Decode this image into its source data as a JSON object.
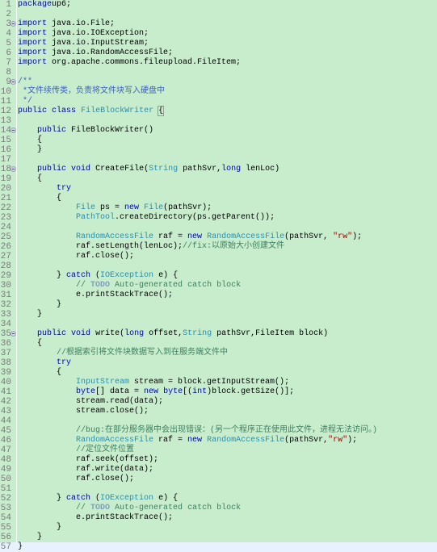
{
  "editor": {
    "language": "java",
    "colors": {
      "background": "#c7edcc",
      "current_line": "#e8f2fe",
      "keyword": "#0000c0",
      "type": "#2a8fb0",
      "string": "#a00000",
      "comment": "#3f7f5f",
      "javadoc": "#3f5fbf",
      "todo": "#7f9fbf",
      "line_number": "#787878"
    },
    "fold_markers": [
      3,
      9,
      14,
      18,
      35
    ],
    "current_line": 57,
    "lines": [
      {
        "n": "1",
        "tokens": [
          [
            "kw",
            "package"
          ],
          [
            "",
            "up6;"
          ]
        ]
      },
      {
        "n": "2",
        "tokens": []
      },
      {
        "n": "3",
        "tokens": [
          [
            "kw",
            "import"
          ],
          [
            "",
            " java.io.File;"
          ]
        ]
      },
      {
        "n": "4",
        "tokens": [
          [
            "kw",
            "import"
          ],
          [
            "",
            " java.io.IOException;"
          ]
        ]
      },
      {
        "n": "5",
        "tokens": [
          [
            "kw",
            "import"
          ],
          [
            "",
            " java.io.InputStream;"
          ]
        ]
      },
      {
        "n": "6",
        "tokens": [
          [
            "kw",
            "import"
          ],
          [
            "",
            " java.io.RandomAccessFile;"
          ]
        ]
      },
      {
        "n": "7",
        "tokens": [
          [
            "kw",
            "import"
          ],
          [
            "",
            " org.apache.commons.fileupload.FileItem;"
          ]
        ]
      },
      {
        "n": "8",
        "tokens": []
      },
      {
        "n": "9",
        "tokens": [
          [
            "jd",
            "/**"
          ]
        ]
      },
      {
        "n": "10",
        "tokens": [
          [
            "jd",
            " *文件续传类，负责将文件块写入硬盘中"
          ]
        ]
      },
      {
        "n": "11",
        "tokens": [
          [
            "jd",
            " */"
          ]
        ]
      },
      {
        "n": "12",
        "tokens": [
          [
            "kw",
            "public"
          ],
          [
            "",
            " "
          ],
          [
            "kw",
            "class"
          ],
          [
            "",
            " "
          ],
          [
            "ty",
            "FileBlockWriter"
          ],
          [
            "",
            " "
          ],
          [
            "brace",
            "{"
          ]
        ]
      },
      {
        "n": "13",
        "tokens": []
      },
      {
        "n": "14",
        "tokens": [
          [
            "",
            "    "
          ],
          [
            "kw",
            "public"
          ],
          [
            "",
            " FileBlockWriter()"
          ]
        ]
      },
      {
        "n": "15",
        "tokens": [
          [
            "",
            "    {"
          ]
        ]
      },
      {
        "n": "16",
        "tokens": [
          [
            "",
            "    }"
          ]
        ]
      },
      {
        "n": "17",
        "tokens": []
      },
      {
        "n": "18",
        "tokens": [
          [
            "",
            "    "
          ],
          [
            "kw",
            "public"
          ],
          [
            "",
            " "
          ],
          [
            "kw",
            "void"
          ],
          [
            "",
            " CreateFile("
          ],
          [
            "ty",
            "String"
          ],
          [
            "",
            " pathSvr,"
          ],
          [
            "kw",
            "long"
          ],
          [
            "",
            " lenLoc)"
          ]
        ]
      },
      {
        "n": "19",
        "tokens": [
          [
            "",
            "    {"
          ]
        ]
      },
      {
        "n": "20",
        "tokens": [
          [
            "",
            "        "
          ],
          [
            "kw",
            "try"
          ]
        ]
      },
      {
        "n": "21",
        "tokens": [
          [
            "",
            "        {"
          ]
        ]
      },
      {
        "n": "22",
        "tokens": [
          [
            "",
            "            "
          ],
          [
            "ty",
            "File"
          ],
          [
            "",
            " ps = "
          ],
          [
            "kw",
            "new"
          ],
          [
            "",
            " "
          ],
          [
            "ty",
            "File"
          ],
          [
            "",
            "(pathSvr);"
          ]
        ]
      },
      {
        "n": "23",
        "tokens": [
          [
            "",
            "            "
          ],
          [
            "ty",
            "PathTool"
          ],
          [
            "",
            ".createDirectory(ps.getParent());"
          ]
        ]
      },
      {
        "n": "24",
        "tokens": []
      },
      {
        "n": "25",
        "tokens": [
          [
            "",
            "            "
          ],
          [
            "ty",
            "RandomAccessFile"
          ],
          [
            "",
            " raf = "
          ],
          [
            "kw",
            "new"
          ],
          [
            "",
            " "
          ],
          [
            "ty",
            "RandomAccessFile"
          ],
          [
            "",
            "(pathSvr, "
          ],
          [
            "str",
            "\"rw\""
          ],
          [
            "",
            ");"
          ]
        ]
      },
      {
        "n": "26",
        "tokens": [
          [
            "",
            "            raf.setLength(lenLoc);"
          ],
          [
            "cm",
            "//fix:以原始大小创建文件"
          ]
        ]
      },
      {
        "n": "27",
        "tokens": [
          [
            "",
            "            raf.close();"
          ]
        ]
      },
      {
        "n": "28",
        "tokens": []
      },
      {
        "n": "29",
        "tokens": [
          [
            "",
            "        } "
          ],
          [
            "kw",
            "catch"
          ],
          [
            "",
            " ("
          ],
          [
            "ty",
            "IOException"
          ],
          [
            "",
            " e) {"
          ]
        ]
      },
      {
        "n": "30",
        "tokens": [
          [
            "",
            "            "
          ],
          [
            "cm",
            "// "
          ],
          [
            "todo",
            "TODO"
          ],
          [
            "cm",
            " Auto-generated catch block"
          ]
        ]
      },
      {
        "n": "31",
        "tokens": [
          [
            "",
            "            e.printStackTrace();"
          ]
        ]
      },
      {
        "n": "32",
        "tokens": [
          [
            "",
            "        }"
          ]
        ]
      },
      {
        "n": "33",
        "tokens": [
          [
            "",
            "    }"
          ]
        ]
      },
      {
        "n": "34",
        "tokens": []
      },
      {
        "n": "35",
        "tokens": [
          [
            "",
            "    "
          ],
          [
            "kw",
            "public"
          ],
          [
            "",
            " "
          ],
          [
            "kw",
            "void"
          ],
          [
            "",
            " write("
          ],
          [
            "kw",
            "long"
          ],
          [
            "",
            " offset,"
          ],
          [
            "ty",
            "String"
          ],
          [
            "",
            " pathSvr,FileItem block)"
          ]
        ]
      },
      {
        "n": "36",
        "tokens": [
          [
            "",
            "    {"
          ]
        ]
      },
      {
        "n": "37",
        "tokens": [
          [
            "",
            "        "
          ],
          [
            "cm",
            "//根据索引将文件块数据写入到在服务端文件中"
          ]
        ]
      },
      {
        "n": "38",
        "tokens": [
          [
            "",
            "        "
          ],
          [
            "kw",
            "try"
          ]
        ]
      },
      {
        "n": "39",
        "tokens": [
          [
            "",
            "        {"
          ]
        ]
      },
      {
        "n": "40",
        "tokens": [
          [
            "",
            "            "
          ],
          [
            "ty",
            "InputStream"
          ],
          [
            "",
            " stream = block.getInputStream();"
          ]
        ]
      },
      {
        "n": "41",
        "tokens": [
          [
            "",
            "            "
          ],
          [
            "kw",
            "byte"
          ],
          [
            "",
            "[] data = "
          ],
          [
            "kw",
            "new"
          ],
          [
            "",
            " "
          ],
          [
            "kw",
            "byte"
          ],
          [
            "",
            "[("
          ],
          [
            "kw",
            "int"
          ],
          [
            "",
            ")block.getSize()];"
          ]
        ]
      },
      {
        "n": "42",
        "tokens": [
          [
            "",
            "            stream.read(data);"
          ]
        ]
      },
      {
        "n": "43",
        "tokens": [
          [
            "",
            "            stream.close();"
          ]
        ]
      },
      {
        "n": "44",
        "tokens": []
      },
      {
        "n": "45",
        "tokens": [
          [
            "",
            "            "
          ],
          [
            "cm",
            "//bug:在部分服务器中会出现错误：(另一个程序正在使用此文件，进程无法访问。)"
          ]
        ]
      },
      {
        "n": "46",
        "tokens": [
          [
            "",
            "            "
          ],
          [
            "ty",
            "RandomAccessFile"
          ],
          [
            "",
            " raf = "
          ],
          [
            "kw",
            "new"
          ],
          [
            "",
            " "
          ],
          [
            "ty",
            "RandomAccessFile"
          ],
          [
            "",
            "(pathSvr,"
          ],
          [
            "str",
            "\"rw\""
          ],
          [
            "",
            ");"
          ]
        ]
      },
      {
        "n": "47",
        "tokens": [
          [
            "",
            "            "
          ],
          [
            "cm",
            "//定位文件位置"
          ]
        ]
      },
      {
        "n": "48",
        "tokens": [
          [
            "",
            "            raf.seek(offset);"
          ]
        ]
      },
      {
        "n": "49",
        "tokens": [
          [
            "",
            "            raf.write(data);"
          ]
        ]
      },
      {
        "n": "50",
        "tokens": [
          [
            "",
            "            raf.close();"
          ]
        ]
      },
      {
        "n": "51",
        "tokens": []
      },
      {
        "n": "52",
        "tokens": [
          [
            "",
            "        } "
          ],
          [
            "kw",
            "catch"
          ],
          [
            "",
            " ("
          ],
          [
            "ty",
            "IOException"
          ],
          [
            "",
            " e) {"
          ]
        ]
      },
      {
        "n": "53",
        "tokens": [
          [
            "",
            "            "
          ],
          [
            "cm",
            "// "
          ],
          [
            "todo",
            "TODO"
          ],
          [
            "cm",
            " Auto-generated catch block"
          ]
        ]
      },
      {
        "n": "54",
        "tokens": [
          [
            "",
            "            e.printStackTrace();"
          ]
        ]
      },
      {
        "n": "55",
        "tokens": [
          [
            "",
            "        }"
          ]
        ]
      },
      {
        "n": "56",
        "tokens": [
          [
            "",
            "    }"
          ]
        ]
      },
      {
        "n": "57",
        "tokens": [
          [
            "",
            "}"
          ]
        ]
      }
    ]
  }
}
